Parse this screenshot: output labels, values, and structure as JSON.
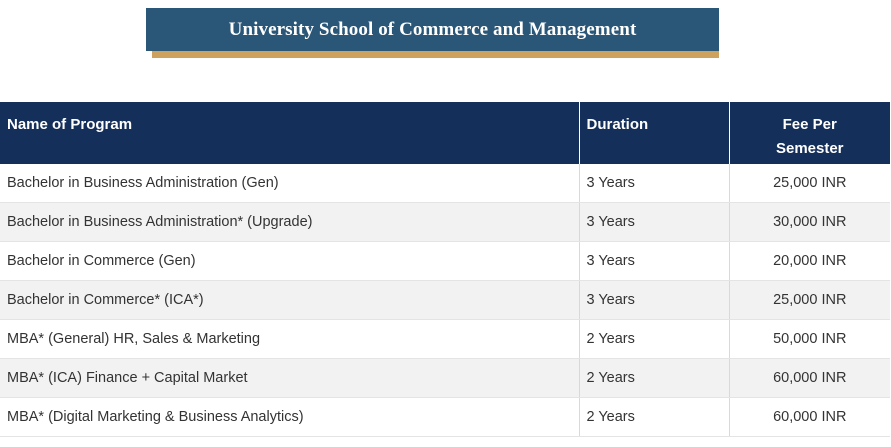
{
  "title": "University School of Commerce and Management",
  "table": {
    "headers": {
      "program": "Name of Program",
      "duration": "Duration",
      "fee": "Fee Per Semester"
    },
    "rows": [
      {
        "program": "Bachelor in Business Administration (Gen)",
        "duration": "3 Years",
        "fee": "25,000 INR"
      },
      {
        "program": "Bachelor in Business Administration* (Upgrade)",
        "duration": "3 Years",
        "fee": "30,000 INR"
      },
      {
        "program": "Bachelor in Commerce (Gen)",
        "duration": "3 Years",
        "fee": "20,000 INR"
      },
      {
        "program": "Bachelor in Commerce* (ICA*)",
        "duration": "3 Years",
        "fee": "25,000 INR"
      },
      {
        "program": "MBA* (General) HR, Sales & Marketing",
        "duration": "2 Years",
        "fee": "50,000 INR"
      },
      {
        "program": "MBA* (ICA) Finance + Capital Market",
        "duration": "2 Years",
        "fee": "60,000 INR"
      },
      {
        "program": "MBA* (Digital Marketing & Business Analytics)",
        "duration": "2 Years",
        "fee": "60,000 INR"
      }
    ]
  },
  "colors": {
    "title_bg": "#2a5677",
    "title_accent": "#cda25e",
    "header_bg": "#142f5a",
    "row_alt": "#f2f2f2"
  }
}
